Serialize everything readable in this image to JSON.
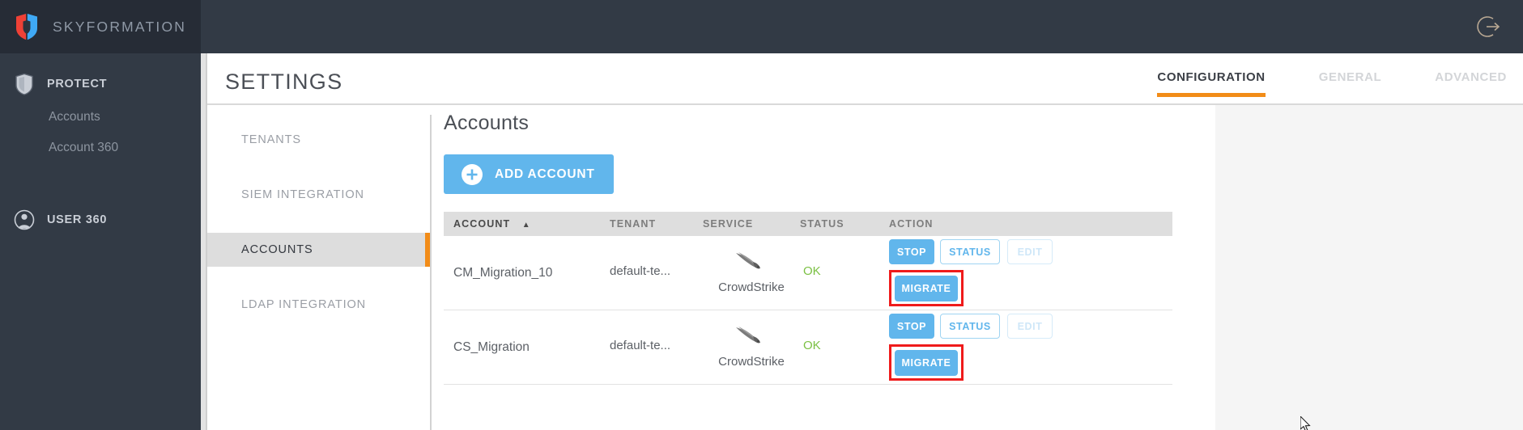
{
  "brand": {
    "name": "SKYFORMATION",
    "logo_icon": "shield-logo-icon"
  },
  "topbar": {
    "logout_icon": "logout-icon"
  },
  "sidebar": {
    "sections": [
      {
        "icon": "shield-icon",
        "label": "PROTECT",
        "children": [
          {
            "label": "Accounts"
          },
          {
            "label": "Account 360"
          }
        ]
      },
      {
        "icon": "user-circle-icon",
        "label": "USER 360",
        "children": []
      }
    ]
  },
  "header": {
    "title": "SETTINGS",
    "tabs": [
      {
        "label": "CONFIGURATION",
        "active": true
      },
      {
        "label": "GENERAL",
        "active": false
      },
      {
        "label": "ADVANCED",
        "active": false
      }
    ]
  },
  "subnav": {
    "items": [
      {
        "label": "TENANTS",
        "active": false
      },
      {
        "label": "SIEM INTEGRATION",
        "active": false
      },
      {
        "label": "ACCOUNTS",
        "active": true
      },
      {
        "label": "LDAP INTEGRATION",
        "active": false
      }
    ]
  },
  "accounts": {
    "title": "Accounts",
    "add_button": {
      "label": "ADD ACCOUNT",
      "icon": "plus-circle-icon"
    },
    "columns": [
      {
        "key": "account",
        "label": "ACCOUNT",
        "sort": "▲"
      },
      {
        "key": "tenant",
        "label": "TENANT"
      },
      {
        "key": "service",
        "label": "SERVICE"
      },
      {
        "key": "status",
        "label": "STATUS"
      },
      {
        "key": "action",
        "label": "ACTION"
      }
    ],
    "rows": [
      {
        "account": "CM_Migration_10",
        "tenant": "default-te...",
        "service": "CrowdStrike",
        "service_icon": "crowdstrike-falcon-icon",
        "status": "OK",
        "actions": {
          "stop": "STOP",
          "status": "STATUS",
          "edit": "EDIT",
          "migrate": "MIGRATE"
        },
        "migrate_highlighted": true
      },
      {
        "account": "CS_Migration",
        "tenant": "default-te...",
        "service": "CrowdStrike",
        "service_icon": "crowdstrike-falcon-icon",
        "status": "OK",
        "actions": {
          "stop": "STOP",
          "status": "STATUS",
          "edit": "EDIT",
          "migrate": "MIGRATE"
        },
        "migrate_highlighted": true
      }
    ]
  },
  "colors": {
    "sidebar_bg": "#323a45",
    "brand_bg": "#262c36",
    "accent_orange": "#f28c18",
    "primary_blue": "#61b6ec",
    "status_ok_green": "#7bc043",
    "highlight_red": "#ef1b1b",
    "logo_red": "#ef4136",
    "logo_blue": "#3fa9f5",
    "panel_bg": "#f5f5f5"
  }
}
